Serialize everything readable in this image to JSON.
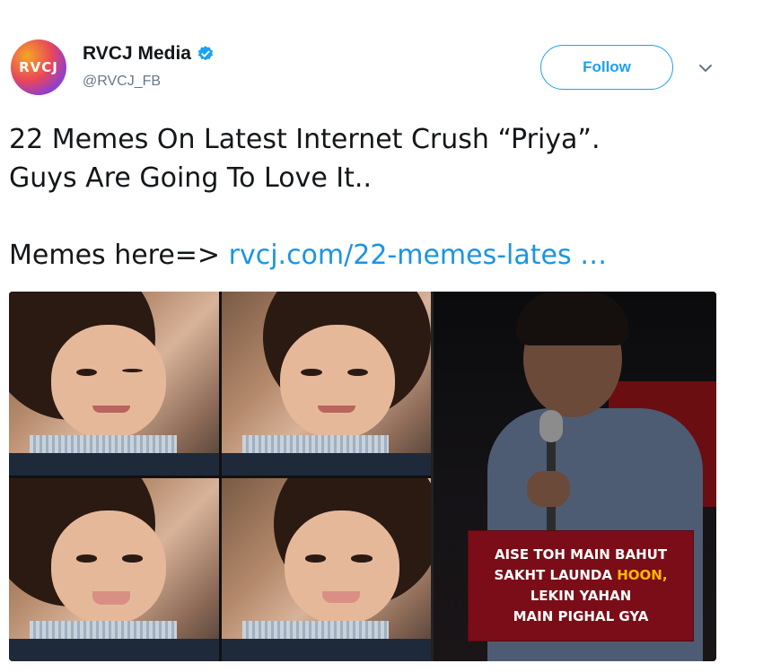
{
  "author": {
    "avatar_text": "RVCJ",
    "name": "RVCJ Media",
    "handle": "@RVCJ_FB",
    "verified_icon": "verified-badge-icon"
  },
  "actions": {
    "follow_label": "Follow",
    "more_icon": "chevron-down-icon"
  },
  "tweet": {
    "line1": "22 Memes On Latest Internet Crush “Priya”.",
    "line2": "Guys Are Going To Love It..",
    "memes_prefix": "Memes here=> ",
    "link_text": "rvcj.com/22-memes-lates …"
  },
  "media": {
    "caption_line1": "AISE TOH MAIN BAHUT",
    "caption_line2a": "SAKHT LAUNDA ",
    "caption_line2b": "HOON,",
    "caption_line3": "LEKIN YAHAN",
    "caption_line4": "MAIN PIGHAL GYA"
  },
  "colors": {
    "accent": "#1da1f2",
    "link": "#1b95e0",
    "caption_bg": "#7a0d17",
    "caption_highlight": "#ffb800"
  }
}
